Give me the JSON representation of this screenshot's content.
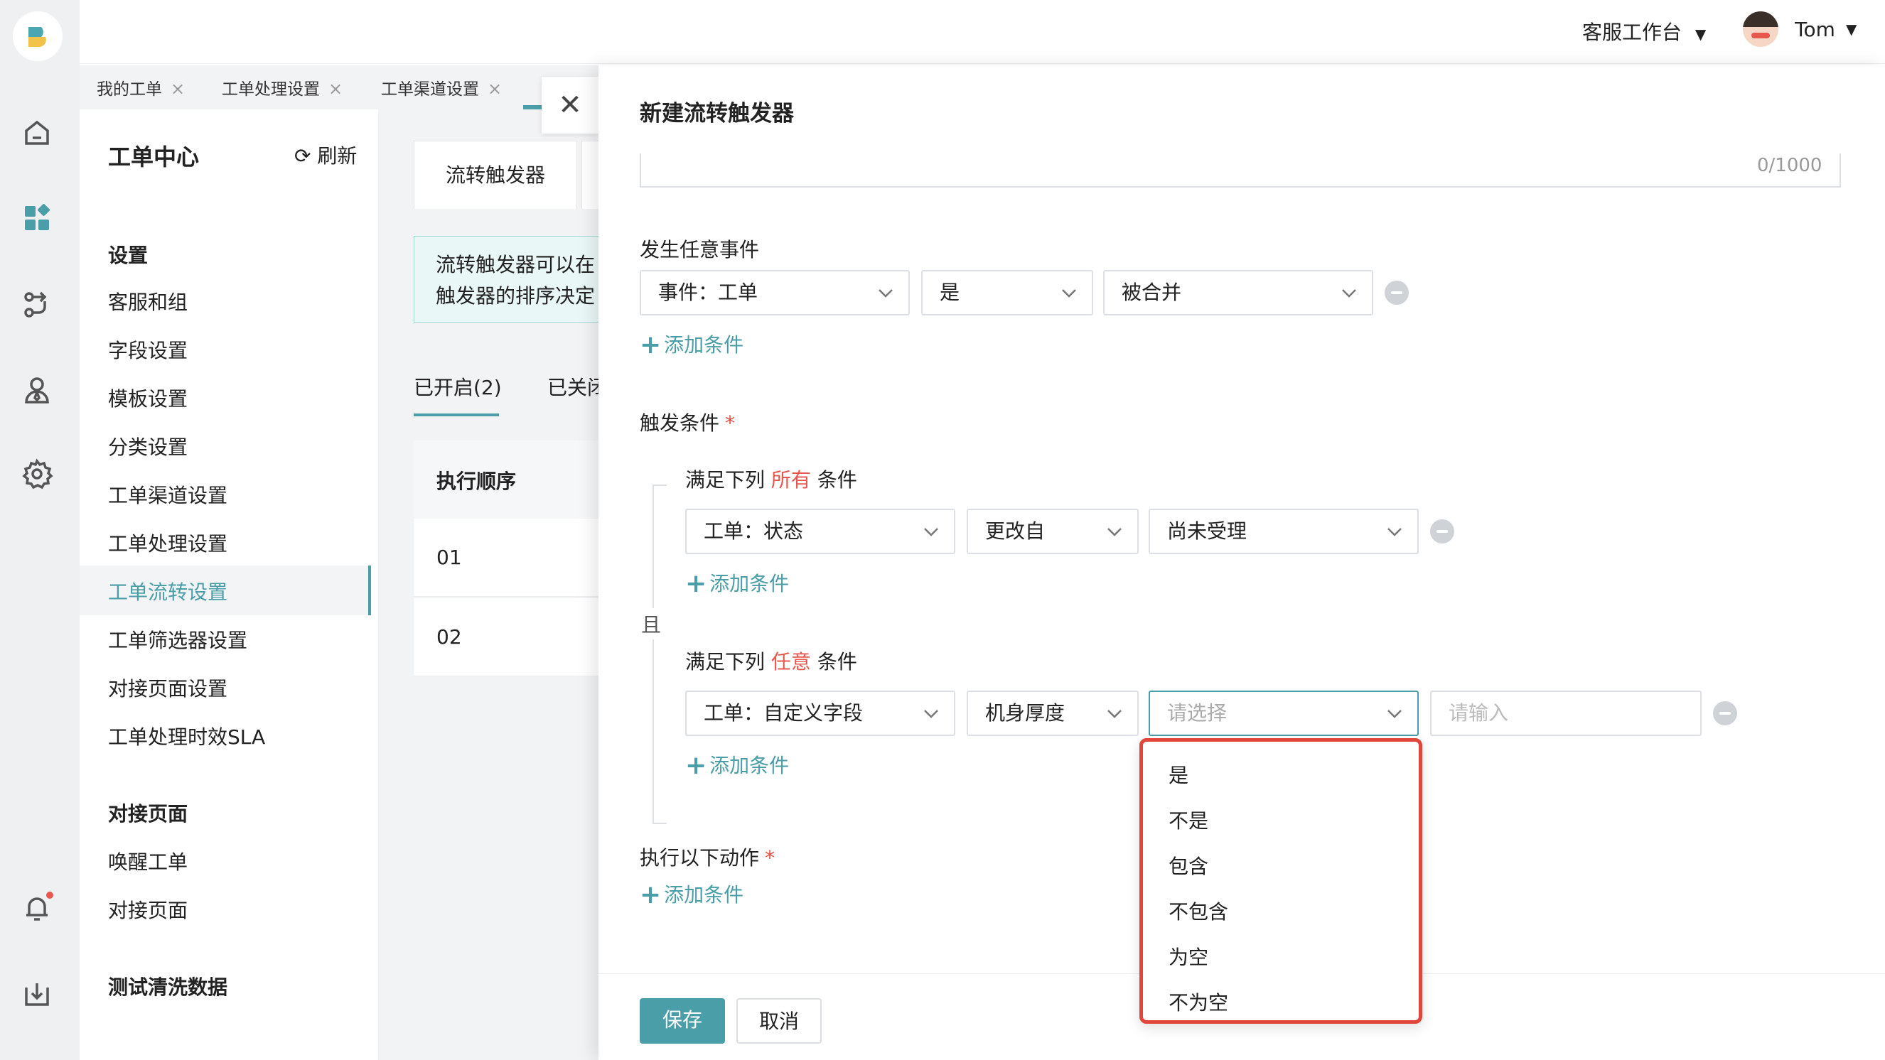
{
  "topbar": {
    "workspace": "客服工作台",
    "user": "Tom"
  },
  "tabs": [
    {
      "label": "我的工单"
    },
    {
      "label": "工单处理设置"
    },
    {
      "label": "工单渠道设置"
    }
  ],
  "sidebar": {
    "title": "工单中心",
    "refresh": "刷新",
    "sections": [
      {
        "header": "设置",
        "items": [
          "客服和组",
          "字段设置",
          "模板设置",
          "分类设置",
          "工单渠道设置",
          "工单处理设置",
          "工单流转设置",
          "工单筛选器设置",
          "对接页面设置",
          "工单处理时效SLA"
        ]
      },
      {
        "header": "对接页面",
        "items": [
          "唤醒工单",
          "对接页面"
        ]
      },
      {
        "header": "测试清洗数据",
        "items": []
      }
    ],
    "active_item": "工单流转设置"
  },
  "middle": {
    "tab": "流转触发器",
    "notice_line1": "流转触发器可以在",
    "notice_line2": "触发器的排序决定",
    "subtabs": [
      "已开启(2)",
      "已关闭"
    ],
    "table_header": "执行顺序",
    "rows": [
      "01",
      "02"
    ]
  },
  "modal": {
    "title": "新建流转触发器",
    "counter": "0/1000",
    "event_section": {
      "label": "发生任意事件",
      "dropdowns": [
        "事件：工单",
        "是",
        "被合并"
      ],
      "add": "添加条件"
    },
    "trigger_section": {
      "label": "触发条件",
      "required": "*",
      "connector": "且",
      "group_all": {
        "prefix": "满足下列",
        "keyword": "所有",
        "suffix": "条件",
        "dropdowns": [
          "工单：状态",
          "更改自",
          "尚未受理"
        ],
        "add": "添加条件"
      },
      "group_any": {
        "prefix": "满足下列",
        "keyword": "任意",
        "suffix": "条件",
        "dropdowns": [
          "工单：自定义字段",
          "机身厚度"
        ],
        "select_placeholder": "请选择",
        "input_placeholder": "请输入",
        "add": "添加条件"
      }
    },
    "action_section": {
      "label": "执行以下动作",
      "required": "*",
      "add": "添加条件"
    },
    "menu_options": [
      "是",
      "不是",
      "包含",
      "不包含",
      "为空",
      "不为空"
    ],
    "save": "保存",
    "cancel": "取消"
  },
  "colors": {
    "accent": "#4a9ea8",
    "required": "#e34b3f",
    "highlight": "#e0473a"
  }
}
